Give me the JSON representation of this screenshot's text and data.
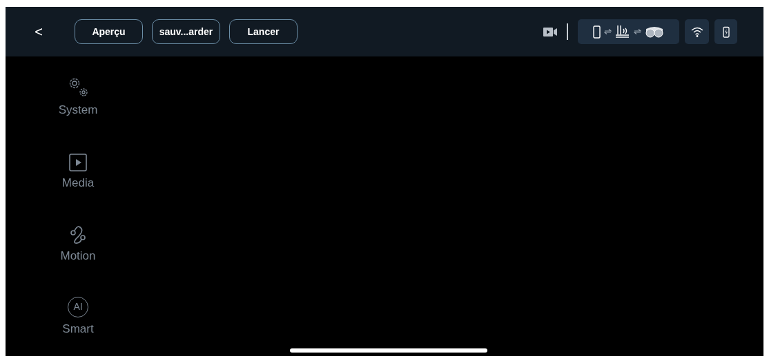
{
  "top_bar": {
    "back": "<",
    "buttons": [
      {
        "label": "Aperçu"
      },
      {
        "label": "sauv...arder"
      },
      {
        "label": "Lancer"
      }
    ]
  },
  "sidebar": {
    "items": [
      {
        "label": "System"
      },
      {
        "label": "Media"
      },
      {
        "label": "Motion"
      },
      {
        "label": "Smart",
        "icon_text": "AI"
      }
    ]
  }
}
